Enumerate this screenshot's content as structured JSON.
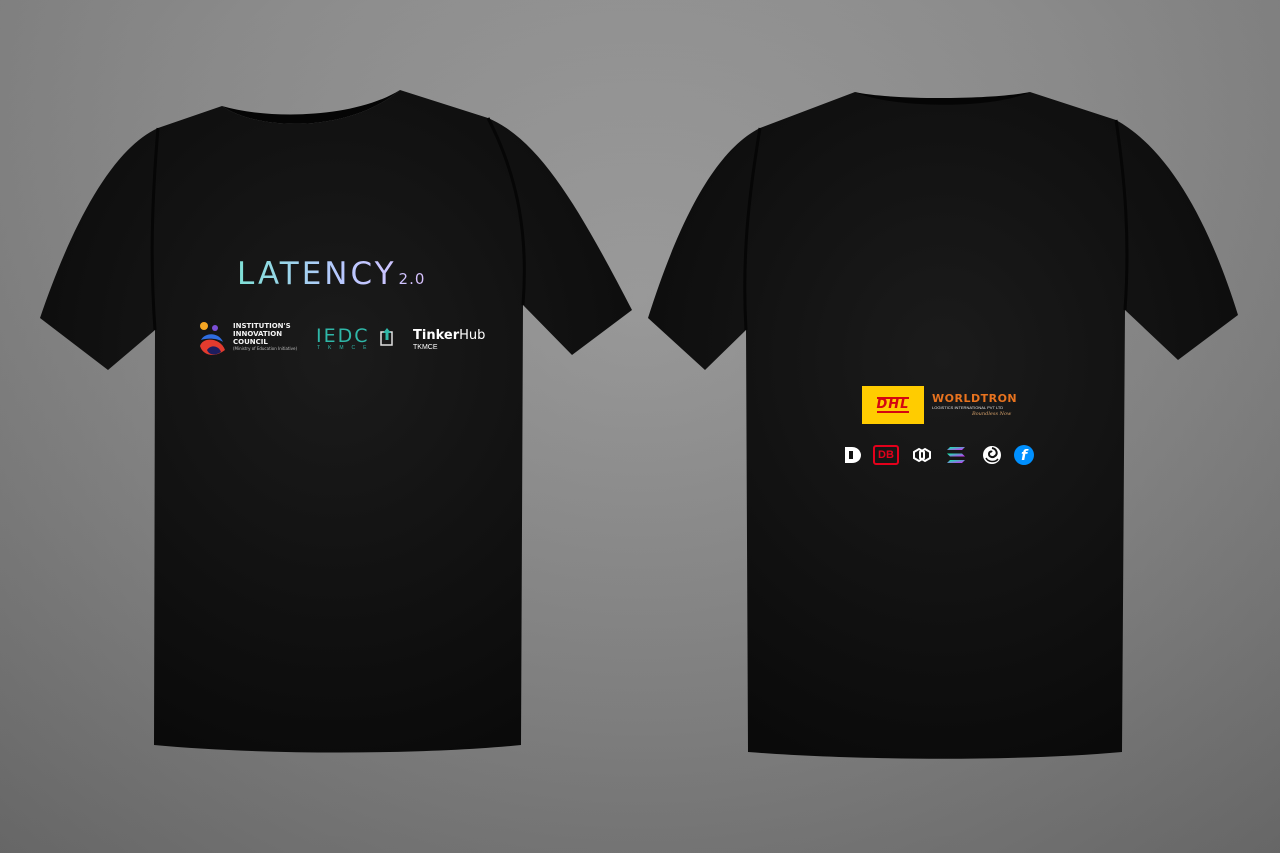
{
  "scene": {
    "background_color": "#8c8c8c",
    "shirt_color": "#121212"
  },
  "front": {
    "event_name": "LATENCY",
    "event_version": "2.0",
    "event_gradient": [
      "#7fe0d6",
      "#b8c8ff",
      "#d9c2ff"
    ],
    "logos": [
      {
        "icon": "institutions-innovation-council-logo",
        "lines": [
          "INSTITUTION'S",
          "INNOVATION",
          "COUNCIL"
        ],
        "subline": "(Ministry of Education Initiative)"
      },
      {
        "icon": "iedc-logo",
        "title": "IEDC",
        "subtitle": "TKMCE",
        "color": "#2fb7a8"
      },
      {
        "icon": "tinkerhub-logo",
        "brand_bold": "Tinker",
        "brand_regular": "Hub",
        "subtitle": "TKMCE"
      }
    ]
  },
  "back": {
    "primary_sponsors": [
      {
        "icon": "dhl-logo",
        "name": "DHL",
        "bg": "#ffcc00",
        "fg": "#d40511"
      },
      {
        "icon": "worldtron-logo",
        "name": "WORLDTRON",
        "subline": "LOGISTICS INTERNATIONAL PVT LTD",
        "tagline": "Boundless Now",
        "color": "#e8731f"
      }
    ],
    "secondary_sponsors": [
      {
        "icon": "d-letter-logo"
      },
      {
        "icon": "deutsche-bahn-logo",
        "text": "DB",
        "color": "#e3001b"
      },
      {
        "icon": "polygon-logo"
      },
      {
        "icon": "solana-logo"
      },
      {
        "icon": "swirl-logo"
      },
      {
        "icon": "filecoin-logo",
        "text": "f",
        "color": "#0090ff"
      }
    ]
  }
}
